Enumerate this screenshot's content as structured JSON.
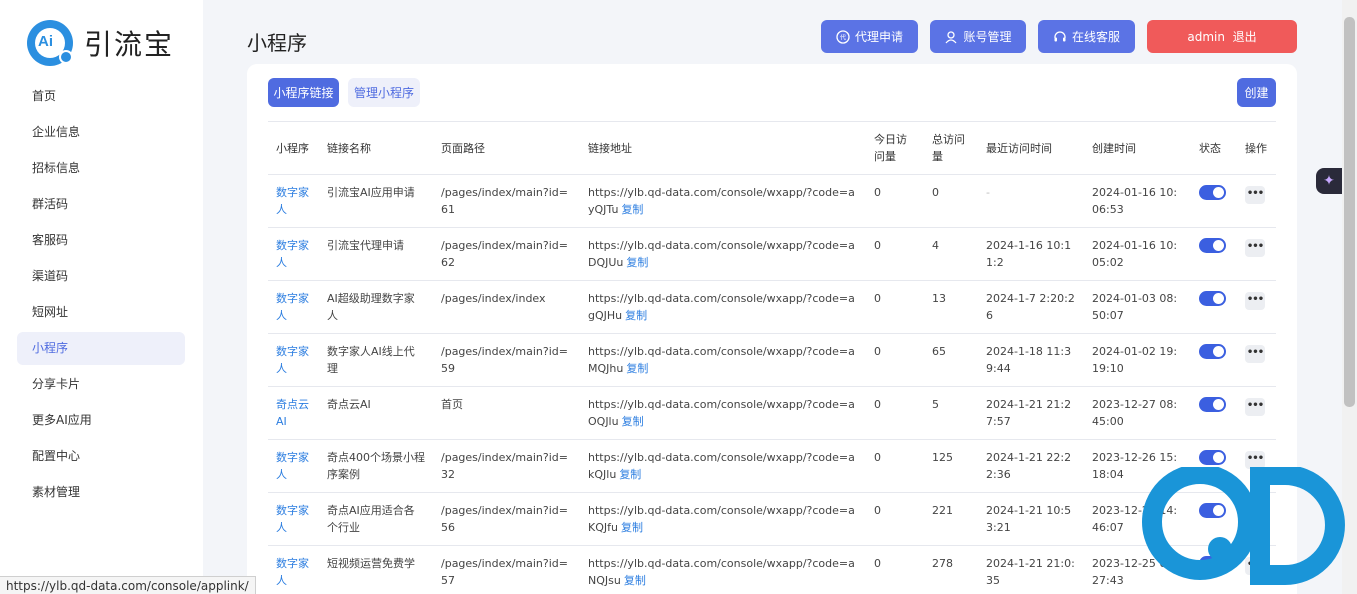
{
  "brand": {
    "name": "引流宝",
    "logo_text": "Ai"
  },
  "sidebar": {
    "items": [
      {
        "label": "首页"
      },
      {
        "label": "企业信息"
      },
      {
        "label": "招标信息"
      },
      {
        "label": "群活码"
      },
      {
        "label": "客服码"
      },
      {
        "label": "渠道码"
      },
      {
        "label": "短网址"
      },
      {
        "label": "小程序",
        "active": true
      },
      {
        "label": "分享卡片"
      },
      {
        "label": "更多AI应用"
      },
      {
        "label": "配置中心"
      },
      {
        "label": "素材管理"
      }
    ]
  },
  "header": {
    "title": "小程序",
    "buttons": {
      "agent": "代理申请",
      "account": "账号管理",
      "support": "在线客服",
      "logout": "admin  退出"
    }
  },
  "tabs": {
    "links": "小程序链接",
    "manage": "管理小程序"
  },
  "create_label": "创建",
  "table": {
    "headers": {
      "app": "小程序",
      "name": "链接名称",
      "path": "页面路径",
      "url": "链接地址",
      "today": "今日访问量",
      "total": "总访问量",
      "last": "最近访问时间",
      "created": "创建时间",
      "status": "状态",
      "action": "操作"
    },
    "copy_label": "复制",
    "rows": [
      {
        "app": "数字家人",
        "name": "引流宝AI应用申请",
        "path": "/pages/index/main?id=61",
        "url": "https://ylb.qd-data.com/console/wxapp/?code=ayQJTu",
        "today": "0",
        "total": "0",
        "last": "-",
        "created": "2024-01-16 10:06:53",
        "on": true
      },
      {
        "app": "数字家人",
        "name": "引流宝代理申请",
        "path": "/pages/index/main?id=62",
        "url": "https://ylb.qd-data.com/console/wxapp/?code=aDQJUu",
        "today": "0",
        "total": "4",
        "last": "2024-1-16 10:11:2",
        "created": "2024-01-16 10:05:02",
        "on": true
      },
      {
        "app": "数字家人",
        "name": "AI超级助理数字家人",
        "path": "/pages/index/index",
        "url": "https://ylb.qd-data.com/console/wxapp/?code=agQJHu",
        "today": "0",
        "total": "13",
        "last": "2024-1-7 2:20:26",
        "created": "2024-01-03 08:50:07",
        "on": true
      },
      {
        "app": "数字家人",
        "name": "数字家人AI线上代理",
        "path": "/pages/index/main?id=59",
        "url": "https://ylb.qd-data.com/console/wxapp/?code=aMQJhu",
        "today": "0",
        "total": "65",
        "last": "2024-1-18 11:39:44",
        "created": "2024-01-02 19:19:10",
        "on": true
      },
      {
        "app": "奇点云AI",
        "name": "奇点云AI",
        "path": "首页",
        "url": "https://ylb.qd-data.com/console/wxapp/?code=aOQJlu",
        "today": "0",
        "total": "5",
        "last": "2024-1-21 21:27:57",
        "created": "2023-12-27 08:45:00",
        "on": true
      },
      {
        "app": "数字家人",
        "name": "奇点400个场景小程序案例",
        "path": "/pages/index/main?id=32",
        "url": "https://ylb.qd-data.com/console/wxapp/?code=akQJlu",
        "today": "0",
        "total": "125",
        "last": "2024-1-21 22:22:36",
        "created": "2023-12-26 15:18:04",
        "on": true
      },
      {
        "app": "数字家人",
        "name": "奇点AI应用适合各个行业",
        "path": "/pages/index/main?id=56",
        "url": "https://ylb.qd-data.com/console/wxapp/?code=aKQJfu",
        "today": "0",
        "total": "221",
        "last": "2024-1-21 10:53:21",
        "created": "2023-12-21 14:46:07",
        "on": true
      },
      {
        "app": "数字家人",
        "name": "短视频运营免费学",
        "path": "/pages/index/main?id=57",
        "url": "https://ylb.qd-data.com/console/wxapp/?code=aNQJsu",
        "today": "0",
        "total": "278",
        "last": "2024-1-21 21:0:35",
        "created": "2023-12-25 09:27:43",
        "on": true
      }
    ]
  },
  "status_url": "https://ylb.qd-data.com/console/applink/",
  "colors": {
    "primary": "#4f6be0",
    "danger": "#f05a5a",
    "link": "#2b7de0"
  }
}
